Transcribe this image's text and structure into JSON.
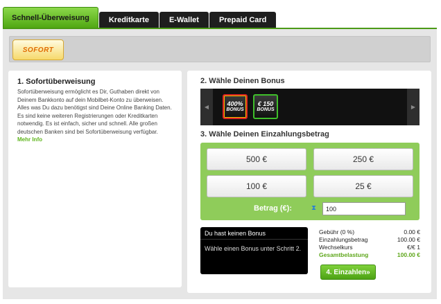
{
  "tabs": [
    {
      "label": "Schnell-Überweisung",
      "active": true
    },
    {
      "label": "Kreditkarte",
      "active": false
    },
    {
      "label": "E-Wallet",
      "active": false
    },
    {
      "label": "Prepaid Card",
      "active": false
    }
  ],
  "logo": {
    "text": "SOFORT"
  },
  "left": {
    "title": "1. Sofortüberweisung",
    "text": "Sofortüberweisung ermöglicht es Dir, Guthaben direkt von Deinem Bankkonto auf dein Mobilbet-Konto zu überweisen. Alles was Du dazu benötigst sind Deine Online Banking Daten. Es sind keine weiteren Registrierungen oder Kreditkarten notwendig. Es ist einfach, sicher und schnell. Alle großen deutschen Banken sind bei Sofortüberweisung verfügbar. ",
    "more": "Mehr Info"
  },
  "bonus_section": {
    "title": "2. Wähle Deinen Bonus",
    "bonuses": [
      {
        "amount": "400%",
        "label": "BONUS"
      },
      {
        "amount": "€ 150",
        "label": "BONUS"
      }
    ]
  },
  "amount_section": {
    "title": "3. Wähle Deinen Einzahlungsbetrag",
    "options": [
      "500 €",
      "250 €",
      "100 €",
      "25 €"
    ],
    "betrag_label": "Betrag (€):",
    "betrag_value": "100"
  },
  "bonus_info": {
    "head": "Du hast keinen Bonus",
    "body": "Wähle einen Bonus unter Schritt 2."
  },
  "summary": {
    "rows": [
      {
        "label": "Gebühr (0 %)",
        "value": "0.00 €"
      },
      {
        "label": "Einzahlungsbetrag",
        "value": "100.00 €"
      },
      {
        "label": "Wechselkurs",
        "value": "€/€ 1"
      }
    ],
    "total_label": "Gesamtbelastung",
    "total_value": "100.00 €"
  },
  "pay_button": "4. Einzahlen»",
  "colors": {
    "accent_green": "#8fcc5a",
    "total_green": "#5fa71c"
  }
}
